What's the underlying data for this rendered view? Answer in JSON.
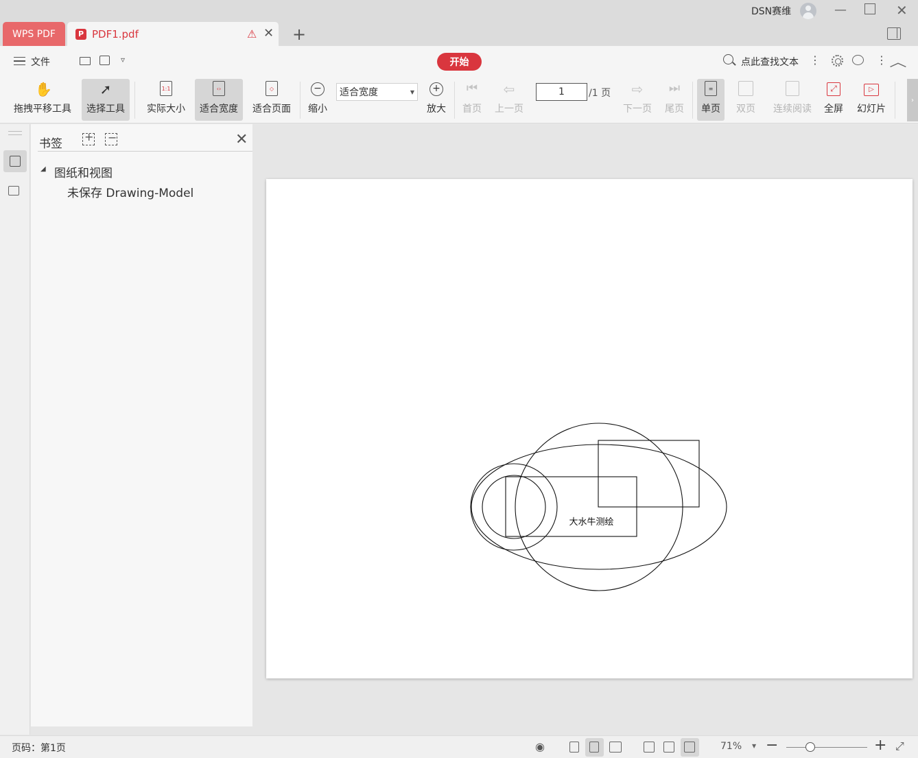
{
  "titlebar": {
    "app_tab": "WPS PDF",
    "doc_tab": "PDF1.pdf",
    "user": "DSN赛维"
  },
  "toolbar": {
    "menu": "文件",
    "start": "开始",
    "search": "点此查找文本",
    "tools": {
      "pan": "拖拽平移工具",
      "select": "选择工具",
      "actual_size": "实际大小",
      "fit_width": "适合宽度",
      "fit_page": "适合页面",
      "zoom_out": "缩小",
      "zoom_in": "放大",
      "first": "首页",
      "prev": "上一页",
      "next": "下一页",
      "last": "尾页",
      "single": "单页",
      "double": "双页",
      "continuous": "连续阅读",
      "fullscreen": "全屏",
      "slideshow": "幻灯片"
    },
    "zoom_mode": "适合宽度",
    "page_current": "1",
    "page_total": "/1 页"
  },
  "bookmarks": {
    "title": "书签",
    "root": "图纸和视图",
    "child": "未保存 Drawing-Model"
  },
  "document": {
    "drawing_text": "大水牛测绘"
  },
  "status": {
    "page": "页码：第1页",
    "zoom": "71%",
    "zoom_fraction": 0.3
  }
}
